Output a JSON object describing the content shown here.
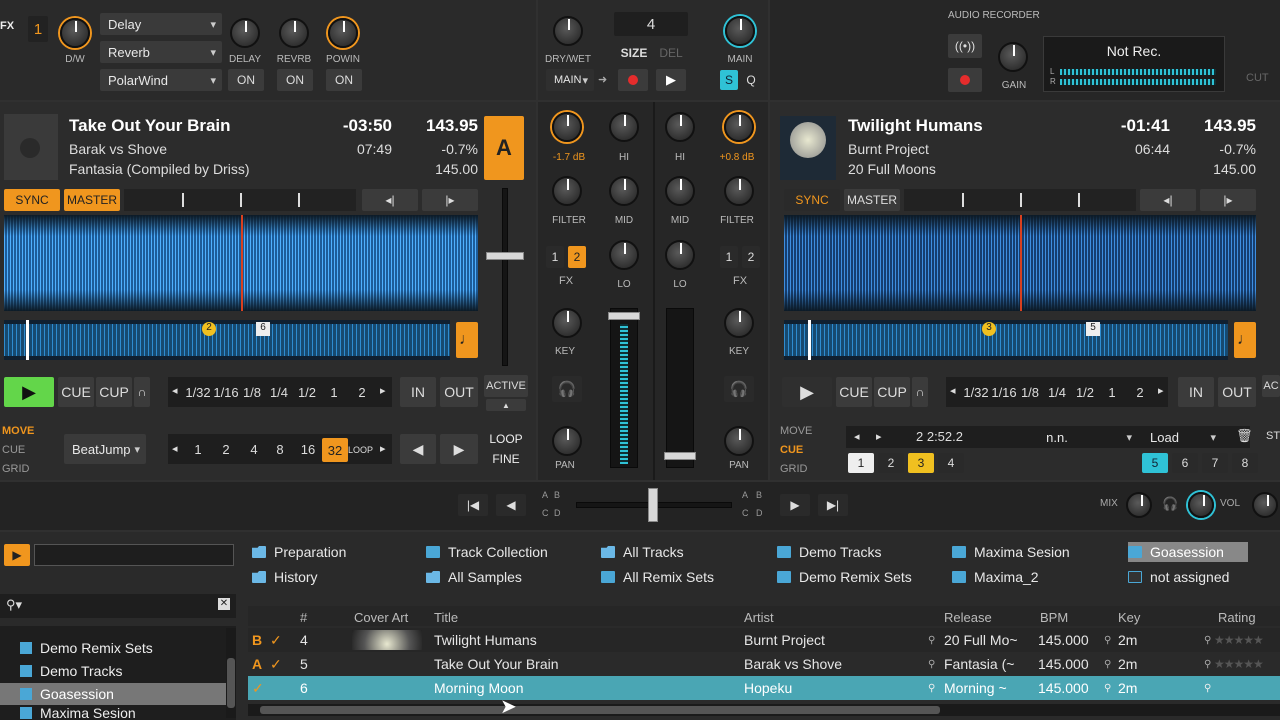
{
  "fx": {
    "label": "FX",
    "unit": "1",
    "dw": "D/W",
    "effects": [
      "Delay",
      "Reverb",
      "PolarWind"
    ],
    "knobs": [
      "DELAY",
      "REVRB",
      "POWIN"
    ],
    "on": [
      "ON",
      "ON",
      "ON"
    ]
  },
  "sampler": {
    "drywet": "DRY/WET",
    "size_value": "4",
    "size": "SIZE",
    "del": "DEL",
    "main_select": "MAIN",
    "main_knob": "MAIN",
    "s": "S",
    "q": "Q"
  },
  "recorder": {
    "title": "AUDIO RECORDER",
    "status": "Not Rec.",
    "gain": "GAIN",
    "cut": "CUT",
    "l": "L",
    "r": "R"
  },
  "deckA": {
    "title": "Take Out Your Brain",
    "artist": "Barak vs Shove",
    "album": "Fantasia (Compiled by Driss)",
    "remaining": "-03:50",
    "length": "07:49",
    "bpm": "143.95",
    "pitch": "-0.7%",
    "orig_bpm": "145.00",
    "letter": "A",
    "sync": "SYNC",
    "master": "MASTER",
    "cue_markers": [
      "2",
      "6"
    ],
    "play_icon": "play-icon",
    "cue": "CUE",
    "cup": "CUP",
    "loops": [
      "1/32",
      "1/16",
      "1/8",
      "1/4",
      "1/2",
      "1",
      "2"
    ],
    "in": "IN",
    "out": "OUT",
    "active": "ACTIVE",
    "modes": [
      "MOVE",
      "CUE",
      "GRID"
    ],
    "beatjump": "BeatJump",
    "jumps": [
      "1",
      "2",
      "4",
      "8",
      "16",
      "32"
    ],
    "loop": "LOOP",
    "loop2": "LOOP",
    "fine": "FINE"
  },
  "deckB": {
    "title": "Twilight Humans",
    "artist": "Burnt Project",
    "album": "20 Full Moons",
    "remaining": "-01:41",
    "length": "06:44",
    "bpm": "143.95",
    "pitch": "-0.7%",
    "orig_bpm": "145.00",
    "sync": "SYNC",
    "master": "MASTER",
    "cue_markers": [
      "3",
      "5"
    ],
    "cue": "CUE",
    "cup": "CUP",
    "loops": [
      "1/32",
      "1/16",
      "1/8",
      "1/4",
      "1/2",
      "1",
      "2"
    ],
    "in": "IN",
    "out": "OUT",
    "active": "AC",
    "modes": [
      "MOVE",
      "CUE",
      "GRID"
    ],
    "cue_pos": "2 2:52.2",
    "cue_name": "n.n.",
    "cue_type": "Load",
    "st": "ST",
    "hotcues": [
      "1",
      "2",
      "3",
      "4",
      "5",
      "6",
      "7",
      "8"
    ]
  },
  "mixer": {
    "gainA": "-1.7 dB",
    "gainB": "+0.8 dB",
    "eq": [
      "HI",
      "MID",
      "LO"
    ],
    "filter": "FILTER",
    "fx": "FX",
    "fx_assign": [
      "1",
      "2"
    ],
    "key": "KEY",
    "pan": "PAN",
    "mix": "MIX",
    "vol": "VOL",
    "cf_a": [
      "A",
      "B",
      "C",
      "D"
    ]
  },
  "browser": {
    "favorites": [
      "Preparation",
      "Track Collection",
      "All Tracks",
      "Demo Tracks",
      "Maxima Sesion",
      "Goasession",
      "History",
      "All Samples",
      "All Remix Sets",
      "Demo Remix Sets",
      "Maxima_2",
      "not assigned"
    ],
    "tree": [
      "Demo Remix Sets",
      "Demo Tracks",
      "Goasession",
      "Maxima Sesion"
    ],
    "columns": [
      "#",
      "Cover Art",
      "Title",
      "Artist",
      "Release",
      "BPM",
      "Key",
      "Rating"
    ],
    "rows": [
      {
        "deck": "B",
        "num": "4",
        "title": "Twilight Humans",
        "artist": "Burnt Project",
        "release": "20 Full Mo~",
        "bpm": "145.000",
        "key": "2m"
      },
      {
        "deck": "A",
        "num": "5",
        "title": "Take Out Your Brain",
        "artist": "Barak vs Shove",
        "release": "Fantasia (~",
        "bpm": "145.000",
        "key": "2m"
      },
      {
        "deck": "",
        "num": "6",
        "title": "Morning Moon",
        "artist": "Hopeku",
        "release": "Morning ~",
        "bpm": "145.000",
        "key": "2m"
      }
    ],
    "check": "✓"
  },
  "colors": {
    "accent": "#f0961e",
    "cyan": "#2fc2d6",
    "play": "#63d64a",
    "wave": "#4fb0ff"
  }
}
